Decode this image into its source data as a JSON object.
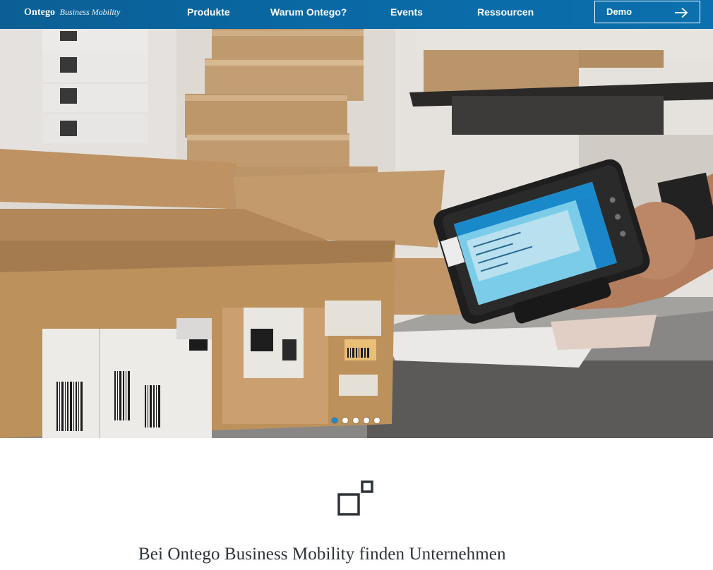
{
  "header": {
    "logo": {
      "brand": "Ontego",
      "sub": "Business Mobility"
    },
    "nav": [
      {
        "label": "Produkte"
      },
      {
        "label": "Warum Ontego?"
      },
      {
        "label": "Events"
      },
      {
        "label": "Ressourcen"
      }
    ],
    "cta": {
      "label": "Demo",
      "icon": "arrow-right-icon"
    }
  },
  "hero": {
    "image": "warehouse-scanner-photo",
    "carousel": {
      "total": 5,
      "active": 1
    }
  },
  "intro": {
    "icon": "squares-icon",
    "text": "Bei Ontego Business Mobility finden Unternehmen"
  },
  "colors": {
    "header": "#0b6aa6",
    "dot_active": "#1e88c8",
    "body_text": "#2d3338"
  }
}
